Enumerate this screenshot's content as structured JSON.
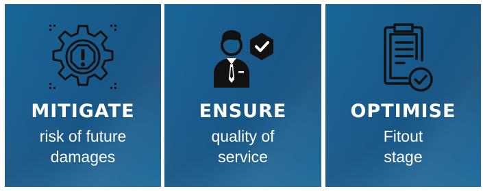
{
  "panels": [
    {
      "title": "MITIGATE",
      "line1": "risk of future",
      "line2": "damages",
      "icon": "gear-warning-icon"
    },
    {
      "title": "ENSURE",
      "line1": "quality of",
      "line2": "service",
      "icon": "person-check-icon"
    },
    {
      "title": "OPTIMISE",
      "line1": "Fitout",
      "line2": "stage",
      "icon": "clipboard-check-icon"
    }
  ],
  "colors": {
    "panel_bg": "#1a6098",
    "text": "#ffffff",
    "icon_dark": "#111111"
  }
}
